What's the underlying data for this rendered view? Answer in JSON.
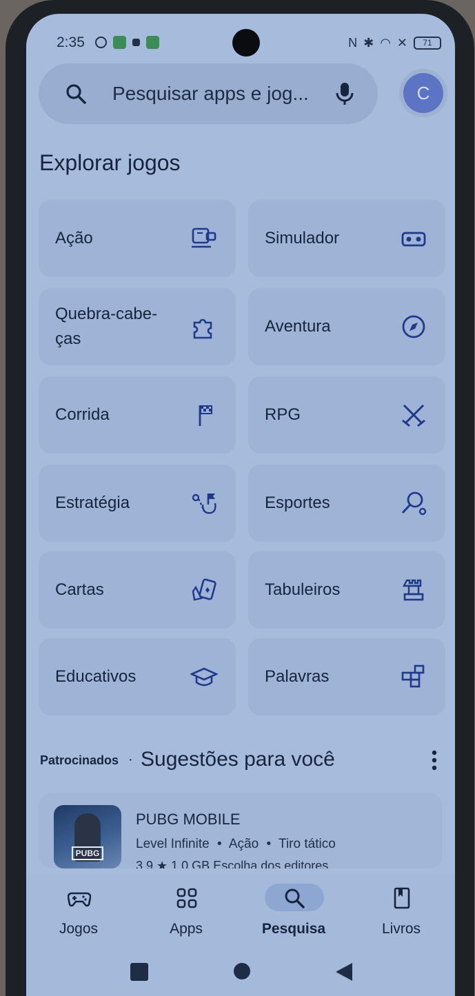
{
  "status_bar": {
    "time": "2:35",
    "battery": "71",
    "nfc_glyph": "N",
    "bluetooth_glyph": "✱",
    "wifi_glyph": "◠",
    "x_glyph": "✕"
  },
  "search": {
    "placeholder": "Pesquisar apps e jog...",
    "avatar_letter": "C"
  },
  "section_title": "Explorar jogos",
  "categories": [
    {
      "label": "Ação",
      "icon": "action-icon"
    },
    {
      "label": "Simulador",
      "icon": "vr-headset-icon"
    },
    {
      "label": "Quebra-cabe-ças",
      "icon": "puzzle-icon"
    },
    {
      "label": "Aventura",
      "icon": "compass-icon"
    },
    {
      "label": "Corrida",
      "icon": "flag-icon"
    },
    {
      "label": "RPG",
      "icon": "crossed-swords-icon"
    },
    {
      "label": "Estratégia",
      "icon": "strategy-icon"
    },
    {
      "label": "Esportes",
      "icon": "tennis-racket-icon"
    },
    {
      "label": "Cartas",
      "icon": "cards-icon"
    },
    {
      "label": "Tabuleiros",
      "icon": "chess-rook-icon"
    },
    {
      "label": "Educativos",
      "icon": "graduation-cap-icon"
    },
    {
      "label": "Palavras",
      "icon": "word-blocks-icon"
    }
  ],
  "suggestions": {
    "sponsored": "Patrocinados",
    "separator": "·",
    "title": "Sugestões para você"
  },
  "app": {
    "name": "PUBG MOBILE",
    "developer": "Level Infinite",
    "genre": "Ação",
    "subgenre": "Tiro tático",
    "meta_sep": "•",
    "thumb_logo": "PUBG",
    "partial_line": "3,9 ★  1,0 GB   Escolha dos editores"
  },
  "nav": {
    "items": [
      {
        "label": "Jogos",
        "icon": "gamepad-icon",
        "active": false
      },
      {
        "label": "Apps",
        "icon": "apps-grid-icon",
        "active": false
      },
      {
        "label": "Pesquisa",
        "icon": "search-icon",
        "active": true
      },
      {
        "label": "Livros",
        "icon": "book-icon",
        "active": false
      }
    ]
  },
  "colors": {
    "screen_bg": "#a7bbdc",
    "icon_blue": "#1f3a8a",
    "text": "#17243d"
  }
}
